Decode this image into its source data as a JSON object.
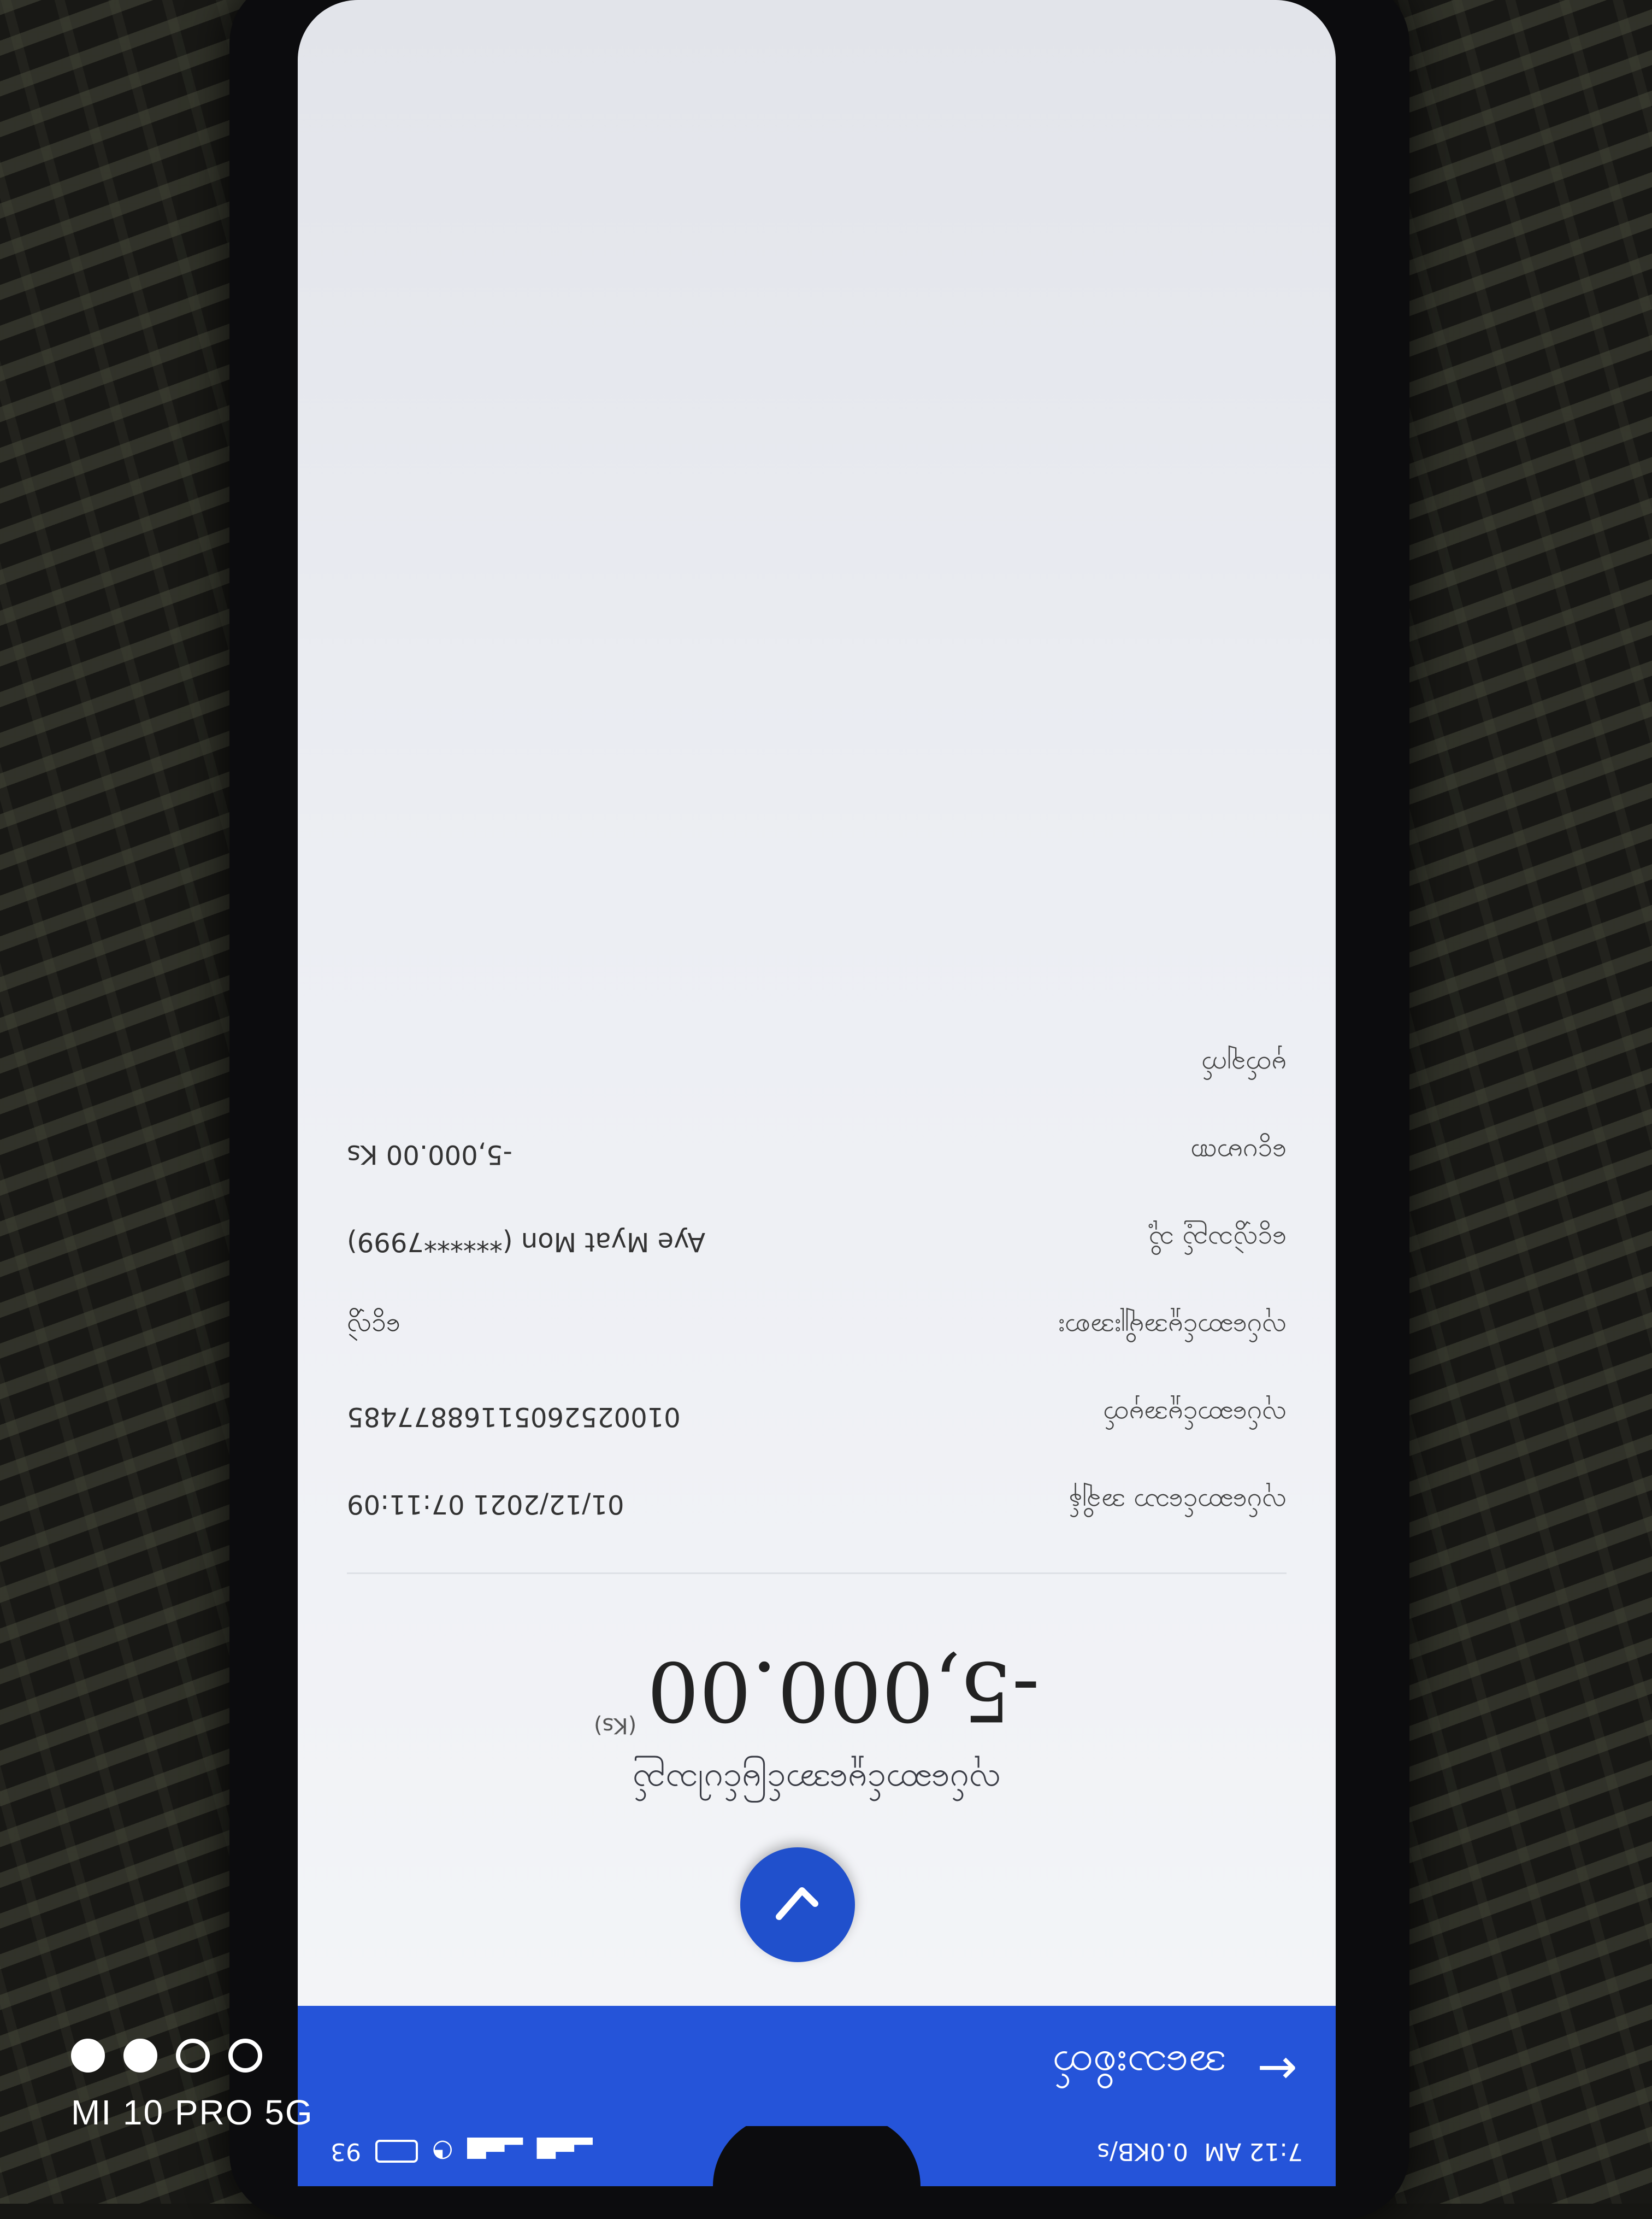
{
  "status_bar": {
    "time": "7:12 AM",
    "network_speed": "0.0KB/s",
    "battery": "93"
  },
  "header": {
    "title": "အသေးစိတ်"
  },
  "transaction": {
    "status_label": "လုပ်ဆောင်မှုအောင်မြင်ပါသည်",
    "amount": "-5,000.00",
    "currency": "(Ks)"
  },
  "details": [
    {
      "label": "လုပ်ဆောင်သော အချိန်",
      "value": "01/12/2021 07:11:09"
    },
    {
      "label": "လုပ်ဆောင်မှုအမှတ်",
      "value": "01002526051168877485"
    },
    {
      "label": "လုပ်ဆောင်မှုအမျိုးအစား",
      "value": "ငွေလွှဲ"
    },
    {
      "label": "ငွေလွှဲသည့် သို့",
      "value": "Aye Myat Mon (******7999)"
    },
    {
      "label": "ငွေပမာဏ",
      "value": "-5,000.00 Ks"
    },
    {
      "label": "မှတ်ချက်",
      "value": ""
    }
  ],
  "watermark": {
    "text": "MI 10 PRO 5G"
  },
  "colors": {
    "accent": "#2554d9",
    "background": "#f0f1f5"
  }
}
